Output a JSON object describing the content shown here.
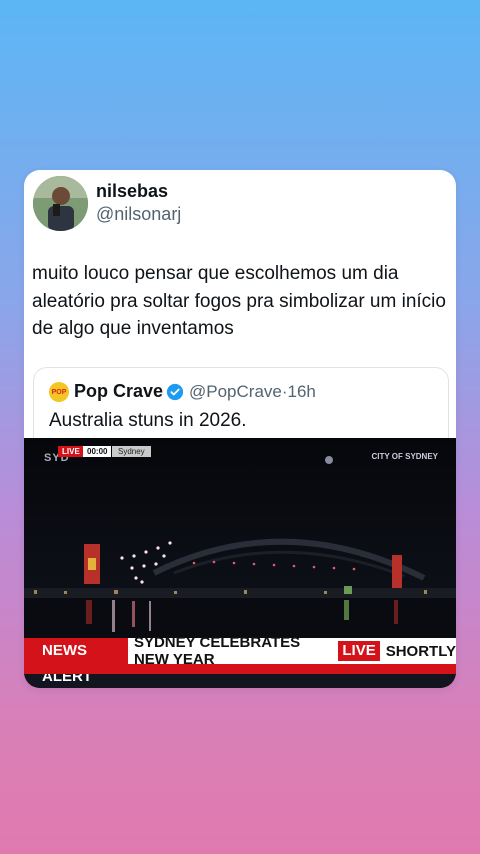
{
  "post": {
    "author_name": "nilsebas",
    "author_handle": "@nilsonarj",
    "text": "muito louco pensar que escolhemos um dia aleatório pra soltar fogos pra simbolizar um início de algo que inventamos"
  },
  "quote": {
    "logo_text": "POP",
    "author_name": "Pop Crave",
    "verified": true,
    "author_handle": "@PopCrave",
    "time": "·16h",
    "text": "Australia stuns in 2026."
  },
  "video": {
    "watermark_left": "SYD",
    "live_label": "LIVE",
    "clock": "00:00",
    "location": "Sydney",
    "watermark_right": "CITY OF SYDNEY",
    "ticker": {
      "alert_label": "NEWS ALERT",
      "headline": "SYDNEY CELEBRATES NEW YEAR",
      "live_label": "LIVE",
      "suffix": "SHORTLY"
    }
  },
  "colors": {
    "accent_red": "#d3121a",
    "verified_blue": "#1d9bf0"
  }
}
